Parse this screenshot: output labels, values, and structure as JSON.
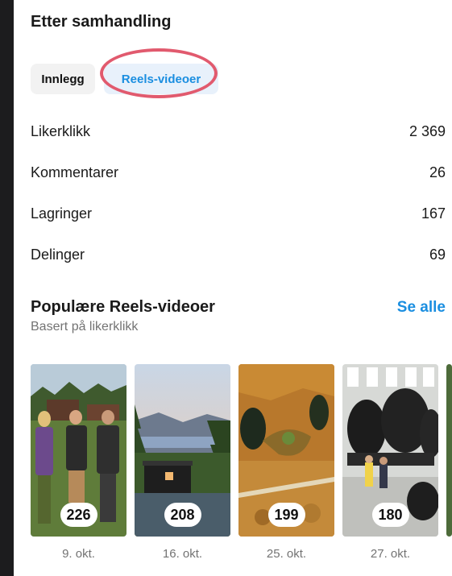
{
  "interactions": {
    "title": "Etter samhandling",
    "tabs": [
      {
        "label": "Innlegg",
        "active": false
      },
      {
        "label": "Reels-videoer",
        "active": true
      }
    ],
    "metrics": [
      {
        "label": "Likerklikk",
        "value": "2 369"
      },
      {
        "label": "Kommentarer",
        "value": "26"
      },
      {
        "label": "Lagringer",
        "value": "167"
      },
      {
        "label": "Delinger",
        "value": "69"
      }
    ]
  },
  "popular": {
    "title": "Populære Reels-videoer",
    "subtitle": "Basert på likerklikk",
    "see_all": "Se alle",
    "reels": [
      {
        "count": "226",
        "date": "9. okt."
      },
      {
        "count": "208",
        "date": "16. okt."
      },
      {
        "count": "199",
        "date": "25. okt."
      },
      {
        "count": "180",
        "date": "27. okt."
      }
    ]
  },
  "colors": {
    "accent": "#1a8ee0",
    "highlight_ring": "#e15a6e",
    "background_dark": "#1c1c1e"
  }
}
